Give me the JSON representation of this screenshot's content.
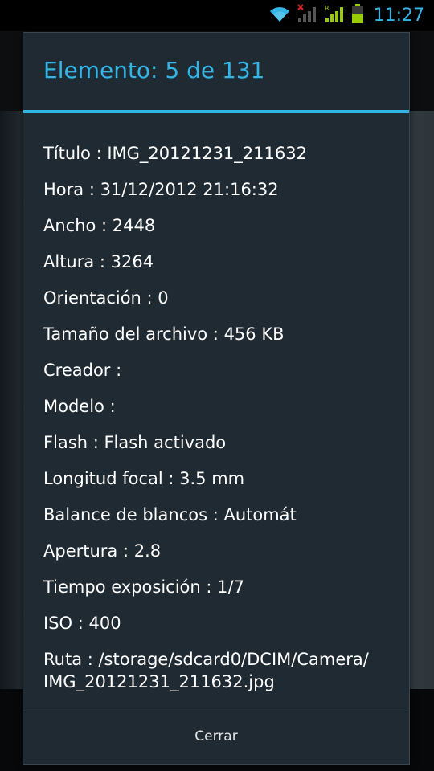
{
  "status_bar": {
    "time": "11:27",
    "icons": [
      "wifi-icon",
      "signal-no-service-icon",
      "signal-roaming-icon",
      "battery-icon"
    ]
  },
  "dialog": {
    "title": "Elemento: 5 de 131",
    "rows": [
      "Título : IMG_20121231_211632",
      "Hora : 31/12/2012 21:16:32",
      "Ancho : 2448",
      "Altura : 3264",
      "Orientación : 0",
      "Tamaño del archivo : 456 KB",
      "Creador :",
      "Modelo :",
      "Flash : Flash activado",
      "Longitud focal : 3.5 mm",
      "Balance de blancos : Automát",
      "Apertura : 2.8",
      "Tiempo exposición : 1/7",
      "ISO : 400"
    ],
    "path_line1": "Ruta : /storage/sdcard0/DCIM/Camera/",
    "path_line2": "IMG_20121231_211632.jpg",
    "close_label": "Cerrar"
  }
}
